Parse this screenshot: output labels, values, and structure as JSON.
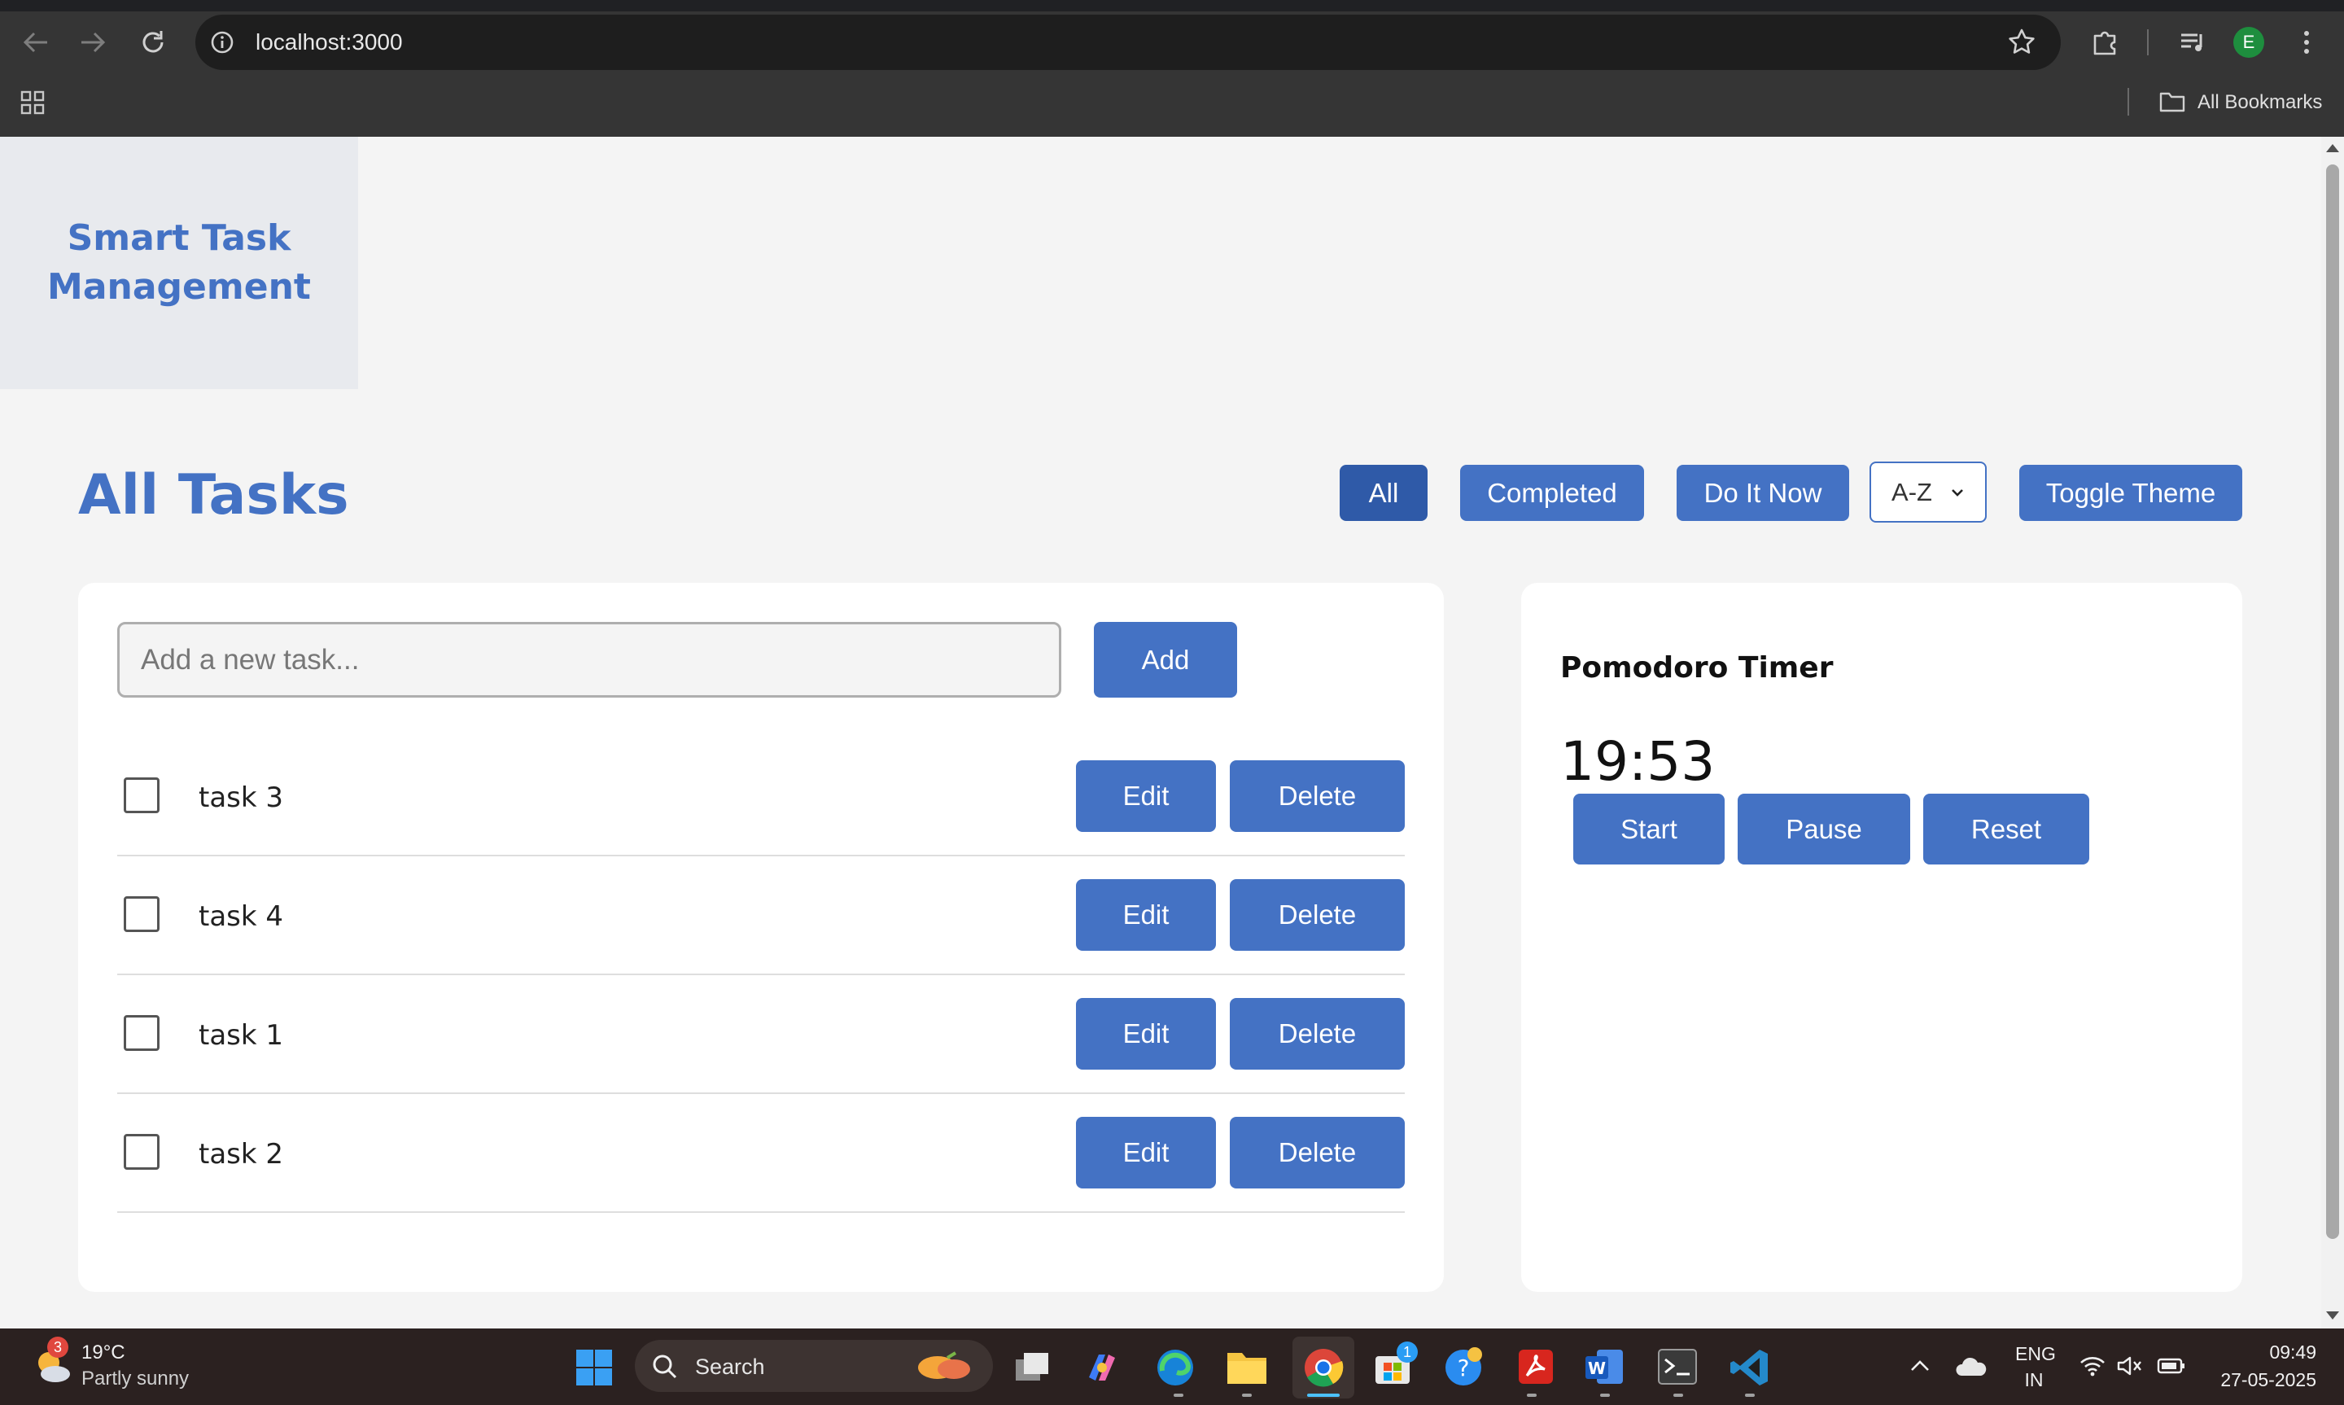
{
  "browser": {
    "url": "localhost:3000",
    "bookmarks_label": "All Bookmarks",
    "profile_initial": "E"
  },
  "app": {
    "title": "Smart Task Management",
    "page_title": "All Tasks",
    "filters": {
      "all": "All",
      "completed": "Completed",
      "do_it_now": "Do It Now",
      "sort_value": "A-Z",
      "toggle_theme": "Toggle Theme"
    },
    "input": {
      "placeholder": "Add a new task...",
      "value": ""
    },
    "add_label": "Add",
    "tasks": [
      {
        "label": "task 3",
        "completed": false
      },
      {
        "label": "task 4",
        "completed": false
      },
      {
        "label": "task 1",
        "completed": false
      },
      {
        "label": "task 2",
        "completed": false
      }
    ],
    "edit_label": "Edit",
    "delete_label": "Delete",
    "timer": {
      "title": "Pomodoro Timer",
      "value": "19:53",
      "start": "Start",
      "pause": "Pause",
      "reset": "Reset"
    }
  },
  "taskbar": {
    "weather": {
      "temp": "19°C",
      "condition": "Partly sunny",
      "badge": "3"
    },
    "search_label": "Search",
    "store_badge": "1",
    "language": {
      "line1": "ENG",
      "line2": "IN"
    },
    "time": "09:49",
    "date": "27-05-2025"
  },
  "colors": {
    "accent": "#4472c4",
    "accent_active": "#2f5aa8",
    "chrome_bg": "#353535",
    "taskbar_bg": "#2b2120"
  }
}
